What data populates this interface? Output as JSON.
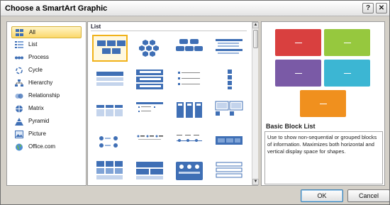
{
  "dialog": {
    "title": "Choose a SmartArt Graphic",
    "help_glyph": "?",
    "close_glyph": "✕"
  },
  "categories": [
    {
      "label": "All",
      "icon": "grid-icon",
      "selected": true
    },
    {
      "label": "List",
      "icon": "list-icon"
    },
    {
      "label": "Process",
      "icon": "process-icon"
    },
    {
      "label": "Cycle",
      "icon": "cycle-icon"
    },
    {
      "label": "Hierarchy",
      "icon": "hierarchy-icon"
    },
    {
      "label": "Relationship",
      "icon": "relationship-icon"
    },
    {
      "label": "Matrix",
      "icon": "matrix-icon"
    },
    {
      "label": "Pyramid",
      "icon": "pyramid-icon"
    },
    {
      "label": "Picture",
      "icon": "picture-icon"
    },
    {
      "label": "Office.com",
      "icon": "globe-icon"
    }
  ],
  "gallery": {
    "heading": "List",
    "scroll_up_glyph": "▲",
    "scroll_down_glyph": "▼"
  },
  "preview": {
    "name": "Basic Block List",
    "description": "Use to show non-sequential or grouped blocks of information. Maximizes both horizontal and vertical display space for shapes.",
    "colors": [
      "#d9403f",
      "#96c83e",
      "#7a5aa6",
      "#3cb6d3",
      "#f0901e"
    ]
  },
  "buttons": {
    "ok": "OK",
    "cancel": "Cancel"
  }
}
